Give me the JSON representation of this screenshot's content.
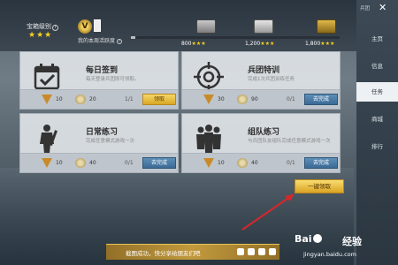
{
  "top": {
    "chest_level_label": "宝箱级别",
    "chest_level_stars": "★★★",
    "weekly_activity_label": "我的本周活跃度",
    "weekly_activity_progress": 0.02,
    "milestones": [
      {
        "value": "800",
        "stars": "★★★"
      },
      {
        "value": "1,200",
        "stars": "★★★"
      },
      {
        "value": "1,800",
        "stars": "★★★"
      }
    ]
  },
  "cards": [
    {
      "title": "每日签到",
      "desc": "每天登录兵团即可领取。",
      "icon": "calendar-check-icon",
      "reward_v": "10",
      "reward_coin": "20",
      "progress": "1/1",
      "button": "领取",
      "button_type": "claim"
    },
    {
      "title": "兵团特训",
      "desc": "完成1次兵团训练任务",
      "icon": "crosshair-icon",
      "reward_v": "30",
      "reward_coin": "90",
      "progress": "0/1",
      "button": "去完成",
      "button_type": "go"
    },
    {
      "title": "日常练习",
      "desc": "完成任意模式游戏一次",
      "icon": "soldier-icon",
      "reward_v": "10",
      "reward_coin": "40",
      "progress": "0/1",
      "button": "去完成",
      "button_type": "go"
    },
    {
      "title": "组队练习",
      "desc": "与兵团队友组队完成任意模式游戏一次",
      "icon": "squad-icon",
      "reward_v": "10",
      "reward_coin": "40",
      "progress": "0/1",
      "button": "去完成",
      "button_type": "go"
    }
  ],
  "claim_all_button": "一键领取",
  "sidebar": {
    "top_label": "兵团",
    "close_glyph": "✕",
    "items": [
      {
        "label": "主页",
        "active": false
      },
      {
        "label": "信息",
        "active": false
      },
      {
        "label": "任务",
        "active": true
      },
      {
        "label": "商城",
        "active": false
      },
      {
        "label": "排行",
        "active": false
      }
    ]
  },
  "notice_text": "截图成功，快分享给朋友们吧",
  "watermark": {
    "logo": "Bai",
    "brand": "经验",
    "url": "jingyan.baidu.com"
  },
  "colors": {
    "accent_gold": "#f5d020",
    "claim_button": "#d9a825",
    "go_button": "#3a6a95",
    "sidebar_active": "#eef1f3"
  }
}
